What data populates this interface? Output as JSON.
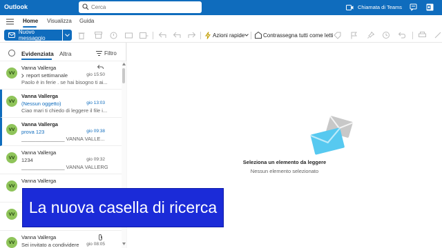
{
  "app": {
    "title": "Outlook"
  },
  "search": {
    "placeholder": "Cerca"
  },
  "header": {
    "teams_call": "Chiamata di Teams"
  },
  "tabs": [
    {
      "label": "Home"
    },
    {
      "label": "Visualizza"
    },
    {
      "label": "Guida"
    }
  ],
  "toolbar": {
    "new_message": "Nuovo messaggio",
    "quick_actions": "Azioni rapide",
    "mark_all_read": "Contrassegna tutti come letti"
  },
  "list": {
    "focused": "Evidenziata",
    "other": "Altra",
    "filter": "Filtro",
    "messages": [
      {
        "initials": "VV",
        "sender": "Vanna Vallerga",
        "subject": "report settimanale",
        "date": "gio 15:50",
        "preview": "Paolo è in ferie . se hai bisogno ti ai...",
        "unread": false
      },
      {
        "initials": "VV",
        "sender": "Vanna Vallerga",
        "subject": "(Nessun oggetto)",
        "date": "gio 13:03",
        "preview": "Ciao mari ti chiedo di leggere il file i...",
        "unread": true
      },
      {
        "initials": "VV",
        "sender": "Vanna Vallerga",
        "subject": "prova 123",
        "date": "gio 09:38",
        "preview": "_______________ VANNA VALLE...",
        "unread": true
      },
      {
        "initials": "VV",
        "sender": "Vanna Vallerga",
        "subject": "1234",
        "date": "gio 09:32",
        "preview": "_______________ VANNA VALLERG...",
        "unread": false
      },
      {
        "initials": "VV",
        "sender": "Vanna Vallerga",
        "subject": "",
        "date": "",
        "preview": "",
        "unread": false
      },
      {
        "initials": "VV",
        "sender": "",
        "subject": "",
        "date": "",
        "preview": "",
        "unread": false
      },
      {
        "initials": "VV",
        "sender": "Vanna Vallerga",
        "subject": "Sei invitato a condividere",
        "date": "gio 08:05",
        "preview": "",
        "unread": false
      }
    ]
  },
  "reading": {
    "empty_title": "Seleziona un elemento da leggere",
    "empty_subtitle": "Nessun elemento selezionato"
  },
  "caption": {
    "text": "La nuova casella di ricerca"
  },
  "colors": {
    "brand": "#0f6cbd",
    "avatar": "#8fc45a",
    "caption_bg": "#1b2bd8"
  }
}
